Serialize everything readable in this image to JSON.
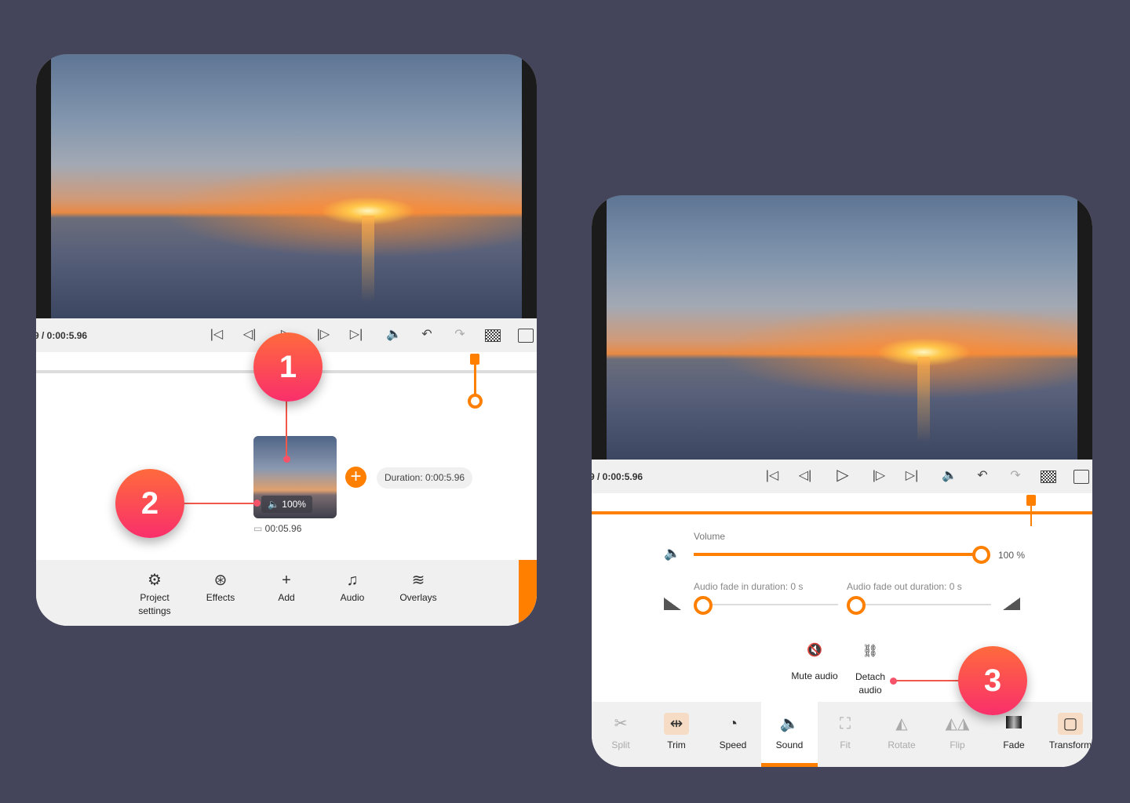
{
  "left_panel": {
    "time_readout": "9 / 0:00:5.96",
    "clip": {
      "volume_label": "100%",
      "length": "00:05.96"
    },
    "duration_label": "Duration: 0:00:5.96",
    "bottom_nav": [
      {
        "label": "Project settings",
        "icon": "gear-icon"
      },
      {
        "label": "Effects",
        "icon": "effects-icon"
      },
      {
        "label": "Add",
        "icon": "plus-icon"
      },
      {
        "label": "Audio",
        "icon": "music-icon"
      },
      {
        "label": "Overlays",
        "icon": "layers-icon"
      }
    ]
  },
  "right_panel": {
    "time_readout": "9 / 0:00:5.96",
    "volume": {
      "label": "Volume",
      "value_label": "100 %",
      "value": 100
    },
    "fade_in": {
      "label": "Audio fade in duration: 0 s",
      "value": 0
    },
    "fade_out": {
      "label": "Audio fade out duration: 0 s",
      "value": 0
    },
    "mute_label": "Mute audio",
    "detach_label": "Detach audio",
    "tabs": [
      {
        "label": "Split",
        "enabled": false
      },
      {
        "label": "Trim",
        "enabled": true
      },
      {
        "label": "Speed",
        "enabled": true
      },
      {
        "label": "Sound",
        "enabled": true,
        "active": true
      },
      {
        "label": "Fit",
        "enabled": false
      },
      {
        "label": "Rotate",
        "enabled": false
      },
      {
        "label": "Flip",
        "enabled": false
      },
      {
        "label": "Fade",
        "enabled": true
      },
      {
        "label": "Transform",
        "enabled": true
      }
    ]
  },
  "callouts": [
    "1",
    "2",
    "3"
  ],
  "colors": {
    "accent": "#ff7f00",
    "background": "#44445a",
    "badge_top": "#ff6a3d",
    "badge_bottom": "#f92f6b"
  }
}
